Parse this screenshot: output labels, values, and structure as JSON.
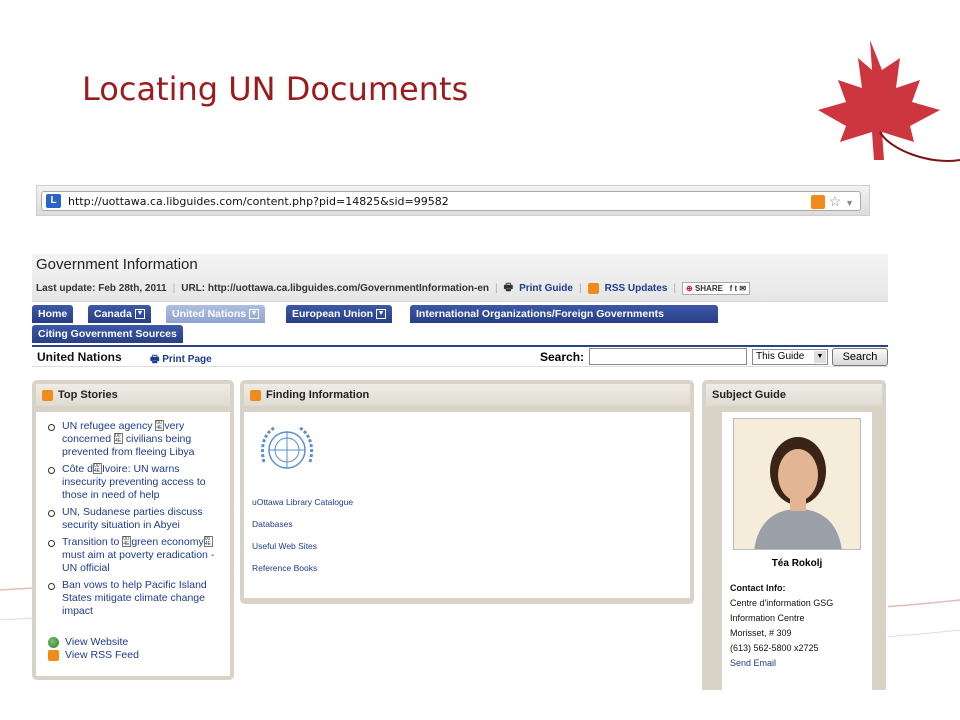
{
  "slide": {
    "title": "Locating UN Documents"
  },
  "browser": {
    "url": "http://uottawa.ca.libguides.com/content.php?pid=14825&sid=99582"
  },
  "guide": {
    "title": "Government Information",
    "last_update": "Last update: Feb 28th, 2011",
    "url": "URL: http://uottawa.ca.libguides.com/GovernmentInformation-en",
    "print_guide": "Print Guide",
    "rss_updates": "RSS Updates",
    "share": "SHARE"
  },
  "tabs": [
    {
      "label": "Home"
    },
    {
      "label": "Canada"
    },
    {
      "label": "United Nations"
    },
    {
      "label": "European Union"
    },
    {
      "label": "International Organizations/Foreign Governments"
    },
    {
      "label": "Citing Government Sources"
    }
  ],
  "subbar": {
    "page_title": "United Nations",
    "print_page": "Print Page",
    "search_label": "Search:",
    "search_value": "",
    "scope": "This Guide",
    "search_button": "Search"
  },
  "top_stories": {
    "title": "Top Stories",
    "items": [
      {
        "a": "UN refugee agency ",
        "b": "very concerned ",
        "c": " civilians being prevented from fleeing Libya"
      },
      {
        "a": "Côte d",
        "b": "Ivoire: UN warns insecurity preventing access to those in need of help",
        "c": ""
      },
      {
        "a": "UN, Sudanese parties discuss security situation in Abyei",
        "b": "",
        "c": ""
      },
      {
        "a": "Transition to ",
        "b": "green economy",
        "c": " must aim at poverty eradication - UN official"
      },
      {
        "a": "Ban vows to help Pacific Island States mitigate climate change impact",
        "b": "",
        "c": ""
      }
    ],
    "view_website": "View Website",
    "view_rss": "View RSS Feed"
  },
  "finding": {
    "title": "Finding Information",
    "links": [
      "uOttawa Library Catalogue",
      "Databases",
      "Useful Web Sites",
      "Reference Books"
    ]
  },
  "subject": {
    "title": "Subject Guide",
    "name": "Téa Rokolj",
    "contact_label": "Contact Info:",
    "lines": [
      "Centre d'information GSG",
      "Information Centre",
      "Morisset, # 309",
      "(613) 562-5800 x2725"
    ],
    "email": "Send Email"
  },
  "colors": {
    "title": "#9b1b1e",
    "tab": "#2f4a94",
    "link": "#1e3c8c",
    "box": "#d8d2c7"
  }
}
